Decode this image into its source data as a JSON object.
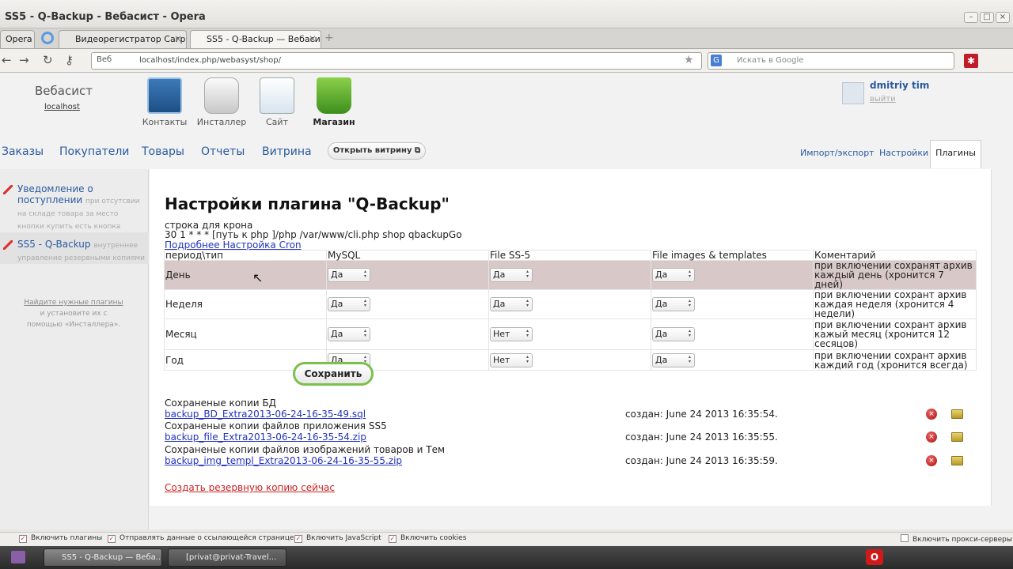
{
  "window": {
    "title": "SS5 - Q-Backup - Вебасист - Opera"
  },
  "tabs": {
    "menu": "Opera",
    "items": [
      {
        "label": "Видеорегистратор Cагра-..."
      },
      {
        "label": "SS5 - Q-Backup — Вебасист"
      }
    ]
  },
  "nav": {
    "web_label": "Веб",
    "url": "localhost/index.php/webasyst/shop/",
    "search_placeholder": "Искать в Google",
    "search_badge": "G"
  },
  "site": {
    "name": "Вебасист",
    "host": "localhost"
  },
  "apps": [
    {
      "label": "Контакты"
    },
    {
      "label": "Инсталлер"
    },
    {
      "label": "Сайт"
    },
    {
      "label": "Магазин"
    }
  ],
  "user": {
    "name": "dmitriy tim",
    "exit": "выйти"
  },
  "menu": {
    "items": [
      "Заказы",
      "Покупатели",
      "Товары",
      "Отчеты",
      "Витрина"
    ],
    "open_vitrina": "Открыть витрину ⧉",
    "right": [
      "Импорт/экспорт",
      "Настройки"
    ],
    "plugins": "Плагины"
  },
  "sidebar": {
    "items": [
      {
        "title": "Уведомление о поступлении",
        "desc": "при отсутсвии на складе товара за место кнопки купить есть кнопка уведомить"
      },
      {
        "title": "SS5 - Q-Backup",
        "desc": "внутреннее управление резервными копиями"
      }
    ],
    "help_link": "Найдите нужные плагины",
    "help_text": "и установите их с помощью «Инсталлера»."
  },
  "plugin": {
    "title": "Настройки плагина \"Q-Backup\"",
    "cron_label": "строка для крона",
    "cron_line": "30 1 * * * [путь к php ]/php /var/www/cli.php shop qbackupGo",
    "cron_link": "Подробнее Настройка Cron",
    "headers": [
      "период\\тип",
      "MySQL",
      "File SS-5",
      "File images & templates",
      "Коментарий"
    ],
    "rows": [
      {
        "period": "День",
        "mysql": "Да",
        "file": "Да",
        "images": "Да",
        "comment": "при включении сохранят архив каждый день (хронится 7 дней)"
      },
      {
        "period": "Неделя",
        "mysql": "Да",
        "file": "Да",
        "images": "Да",
        "comment": "при включении сохрант архив каждая неделя (хронится 4 недели)"
      },
      {
        "period": "Месяц",
        "mysql": "Да",
        "file": "Нет",
        "images": "Да",
        "comment": "при включении сохрант архив кажый месяц (хронится 12 сесяцов)"
      },
      {
        "period": "Год",
        "mysql": "Да",
        "file": "Нет",
        "images": "Да",
        "comment": "при включении сохрант архив каждий год (хронится всегда)"
      }
    ],
    "save_label": "Сохранить",
    "backups": [
      {
        "label": "Сохраненые копии БД",
        "file": "backup_BD_Extra2013-06-24-16-35-49.sql",
        "created": "создан: June 24 2013 16:35:54."
      },
      {
        "label": "Сохраненые копии файлов приложения SS5",
        "file": "backup_file_Extra2013-06-24-16-35-54.zip",
        "created": "создан: June 24 2013 16:35:55."
      },
      {
        "label": "Сохраненые копии файлов изображений товаров и Тем",
        "file": "backup_img_templ_Extra2013-06-24-16-35-55.zip",
        "created": "создан: June 24 2013 16:35:59."
      }
    ],
    "create_now": "Создать резервную копию сейчас"
  },
  "status": {
    "items": [
      "Включить плагины",
      "Отправлять данные о ссылающейся странице",
      "Включить JavaScript",
      "Включить cookies"
    ],
    "proxy": "Включить прокси-серверы"
  },
  "taskbar": {
    "items": [
      "SS5 - Q-Backup — Веба...",
      "[privat@privat-Travel..."
    ]
  },
  "colors": {
    "link": "#2a5aa0",
    "highlight_row": "#d9c8c8",
    "save_border": "#7cc04c",
    "delete": "#c22222"
  }
}
